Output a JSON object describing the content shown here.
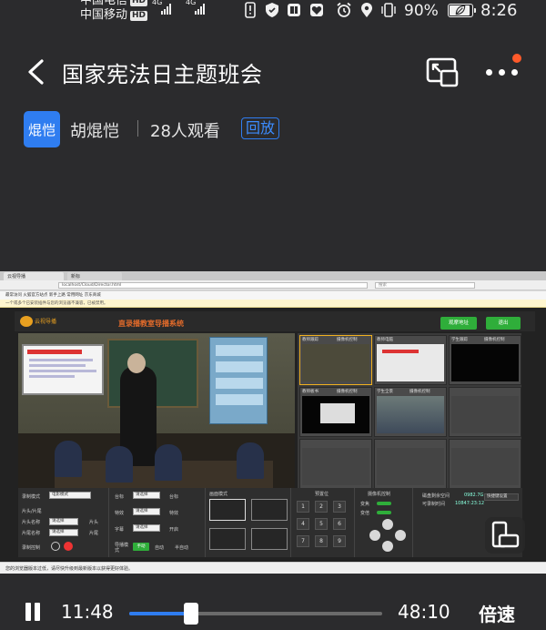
{
  "status_bar": {
    "carrier_1": "中国电信",
    "carrier_2": "中国移动",
    "hd_badge": "HD",
    "network_1": "4G",
    "network_2": "4G",
    "battery_percent": "90%",
    "battery_level": 0.9,
    "time": "8:26",
    "icons": [
      "alert-icon",
      "shield-icon",
      "book-icon",
      "heart-icon",
      "alarm-icon",
      "location-icon",
      "vibrate-icon",
      "leaf-icon"
    ]
  },
  "header": {
    "title": "国家宪法日主题班会",
    "back_icon": "chevron-left-icon",
    "pip_icon": "picture-in-picture-icon",
    "more_icon": "more-dots-icon",
    "notification_dot_color": "#ff5a2a"
  },
  "host": {
    "avatar_text": "焜恺",
    "name": "胡焜恺",
    "viewers": "28人观看",
    "replay_label": "回放",
    "accent": "#2f7df0"
  },
  "video": {
    "browser": {
      "tab_1": "云视导播",
      "tab_2": "新标",
      "url": "localhost/Cloud/Director.html",
      "search_placeholder": "搜索",
      "bookmarks": "最常访问   火狐官方站点   新手上路   常用网址   京东商城",
      "warning": "一个或多个已安装插件与您的浏览器不兼容，已被禁用。",
      "statusbar": "您的浏览器版本过低，请尽快升级到最新版本以获得更好体验。"
    },
    "system": {
      "logo_text": "云视导播",
      "title": "直录播教室导播系统",
      "btn_1": "观摩地址",
      "btn_2": "退出",
      "thumbs": [
        {
          "label": "教师跟踪",
          "checkbox": "摄像机控制"
        },
        {
          "label": "教师电脑",
          "checkbox": ""
        },
        {
          "label": "学生跟踪",
          "checkbox": "摄像机控制"
        },
        {
          "label": "教师板书",
          "checkbox": "摄像机控制"
        },
        {
          "label": "学生全景",
          "checkbox": "摄像机控制"
        },
        {
          "label": "",
          "checkbox": ""
        }
      ],
      "controls": {
        "record_mode_label": "录制模式",
        "record_mode_value": "电影模式",
        "intro_label": "片头/片尾",
        "intro_name_label": "片头名称",
        "outro_name_label": "片尾名称",
        "select_placeholder": "请选择",
        "intro_btn": "片头",
        "outro_btn": "片尾",
        "record_control_label": "录制控制",
        "caption_label": "台标",
        "caption_btn": "台标",
        "effect_label": "特效",
        "effect_btn": "特效",
        "subtitle_label": "字幕",
        "subtitle_btn": "开启",
        "director_mode_label": "导播模式",
        "manual_btn": "手动",
        "auto_btn": "自动",
        "semi_auto_btn": "半自动",
        "layout_label": "画面模式",
        "preset_label": "预置位",
        "preset_numbers": [
          "1",
          "2",
          "3",
          "4",
          "5",
          "6",
          "7",
          "8",
          "9"
        ],
        "camera_control_label": "摄像机控制",
        "focus_label": "变焦",
        "zoom_label": "变倍",
        "disk_label": "磁盘剩余空间",
        "disk_value": "0982.7G",
        "remain_label": "可录制时间",
        "remain_value": "10847:23:12",
        "shortcut_btn": "快捷键设置"
      }
    },
    "rotate_icon": "rotate-screen-icon"
  },
  "player": {
    "pause_icon": "pause-icon",
    "current_time": "11:48",
    "duration": "48:10",
    "progress": 0.245,
    "speed_label": "倍速",
    "accent": "#2f7df0"
  }
}
